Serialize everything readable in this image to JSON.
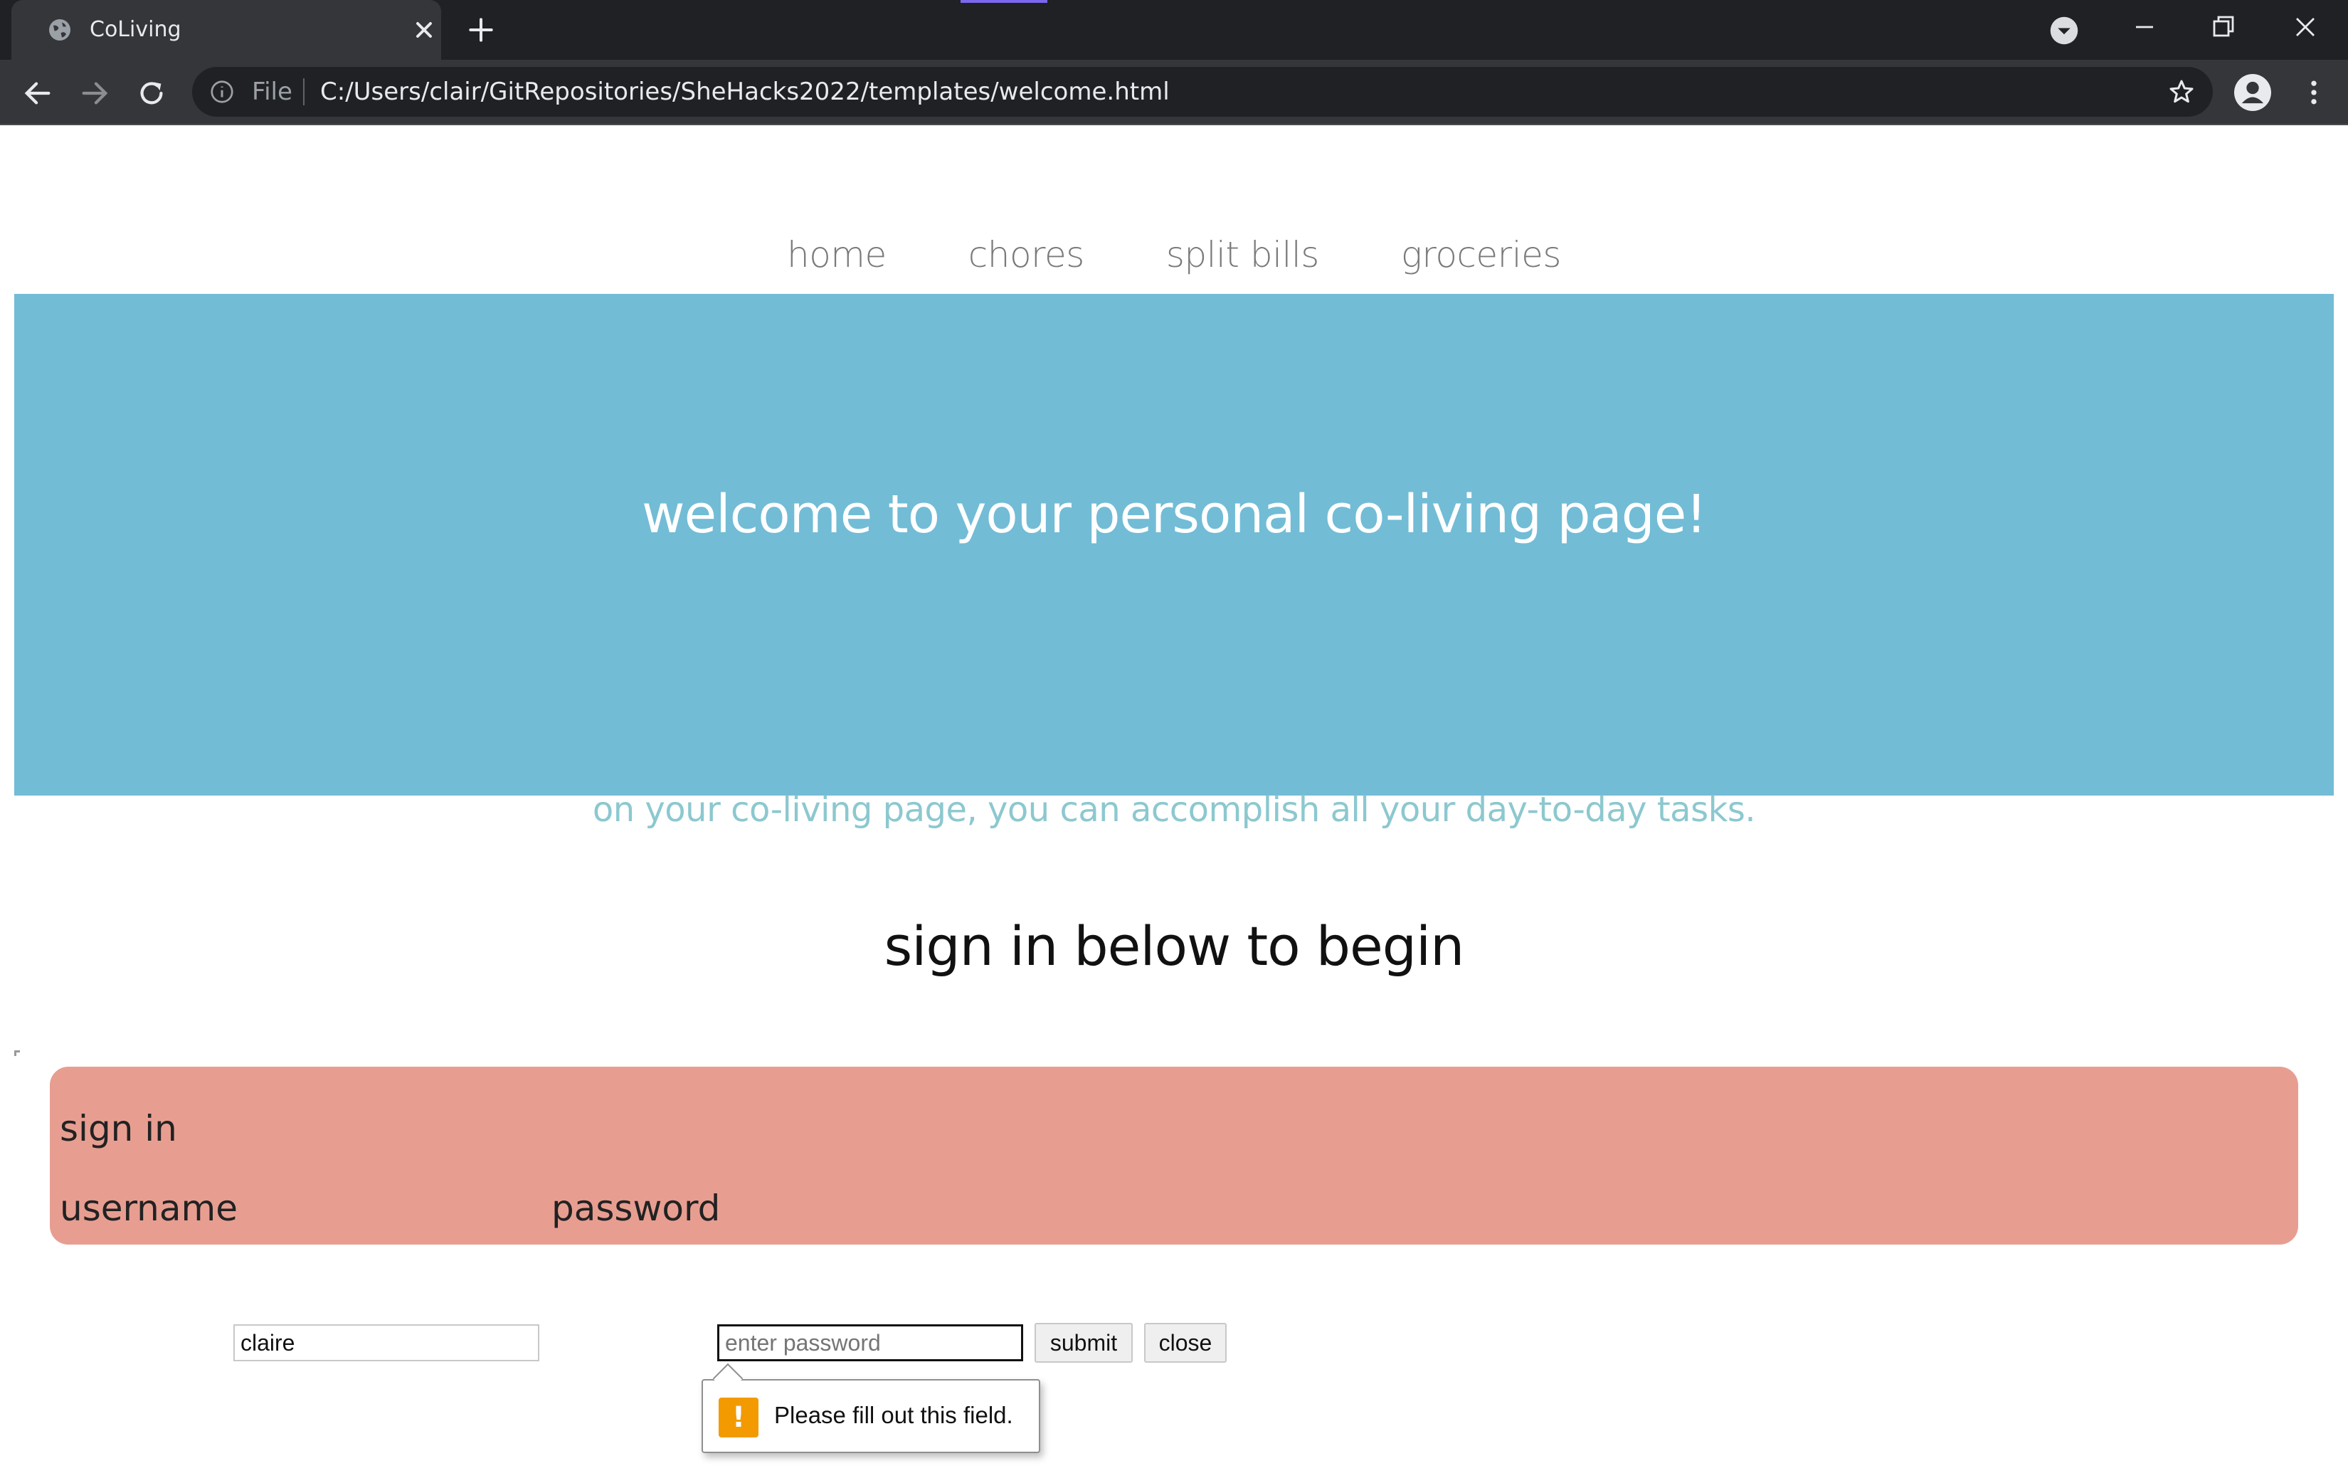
{
  "browser": {
    "tab_title": "CoLiving",
    "url_scheme_label": "File",
    "url": "C:/Users/clair/GitRepositories/SheHacks2022/templates/welcome.html"
  },
  "nav": {
    "items": [
      {
        "label": "home"
      },
      {
        "label": "chores"
      },
      {
        "label": "split bills"
      },
      {
        "label": "groceries"
      }
    ]
  },
  "hero": {
    "title": "welcome to your personal co-living page!",
    "color": "#72bcd6"
  },
  "tagline": "on your co-living page, you can accomplish all your day-to-day tasks.",
  "subheading": "sign in below to begin",
  "signin": {
    "title": "sign in",
    "username_label": "username",
    "username_value": "claire",
    "password_label": "password",
    "password_placeholder": "enter password",
    "submit_label": "submit",
    "close_label": "close",
    "panel_color": "#e79e91"
  },
  "validation": {
    "message": "Please fill out this field.",
    "icon": "warning-icon"
  },
  "icons": {
    "favicon": "globe-icon",
    "tab_close": "close-icon",
    "new_tab": "plus-icon",
    "back": "arrow-left-icon",
    "forward": "arrow-right-icon",
    "reload": "reload-icon",
    "info": "info-icon",
    "bookmark": "star-icon",
    "profile": "person-icon",
    "menu": "kebab-menu-icon"
  }
}
